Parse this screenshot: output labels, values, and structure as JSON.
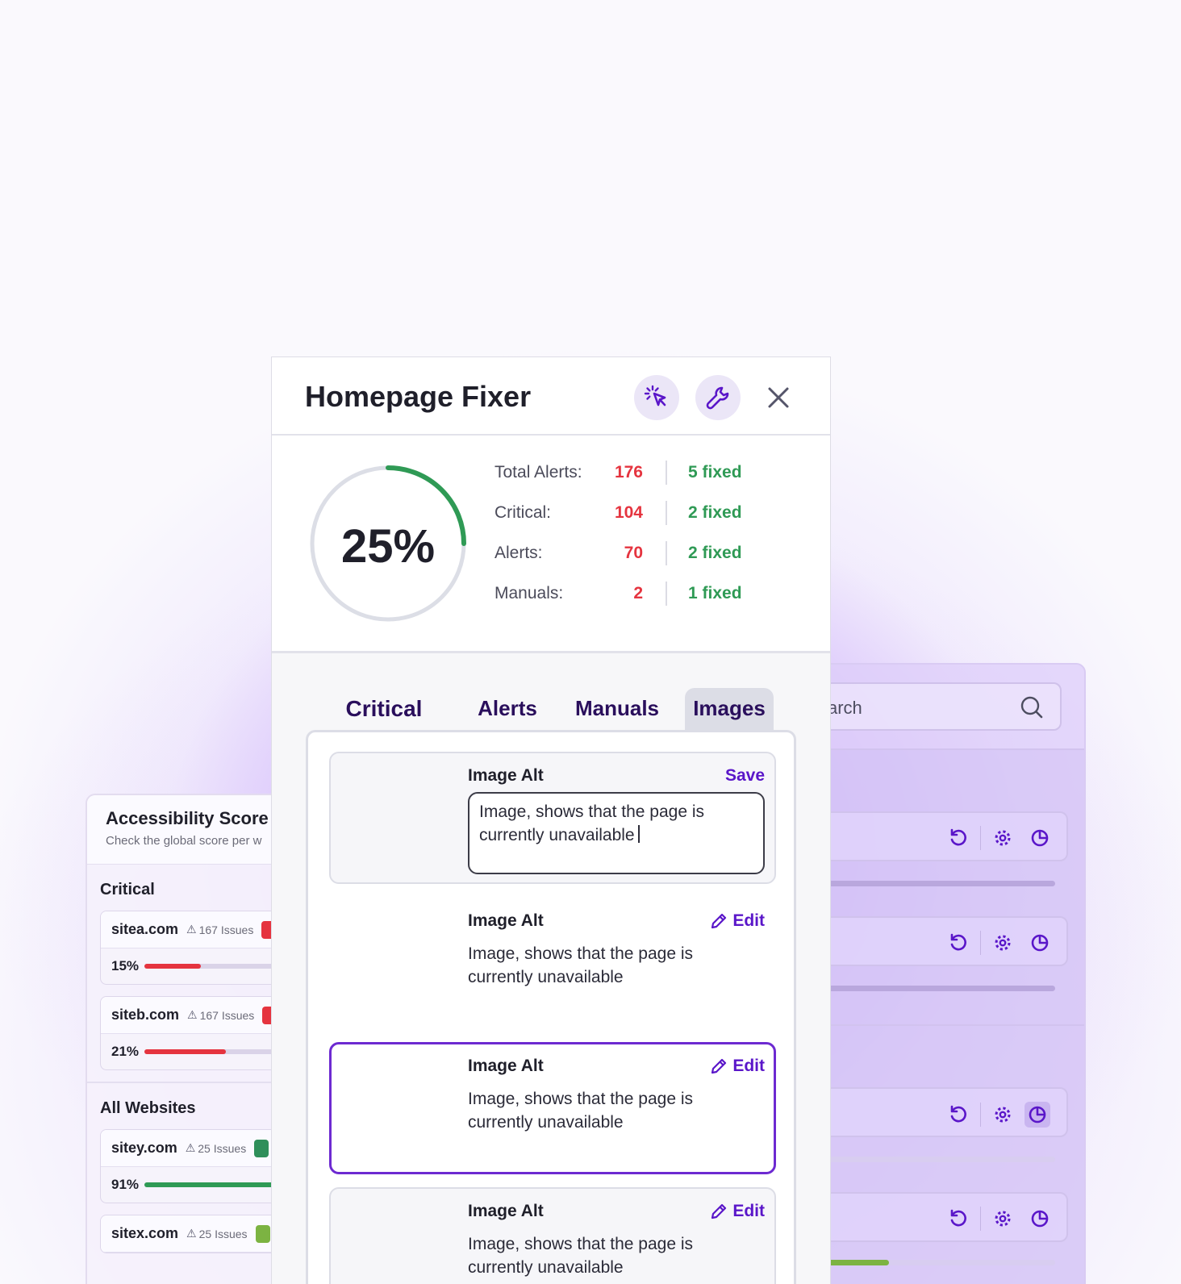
{
  "accessibility_card": {
    "title": "Accessibility Score",
    "subtitle": "Check the global score per w",
    "critical_heading": "Critical",
    "all_heading": "All Websites",
    "critical_sites": [
      {
        "name": "sitea.com",
        "issues": "167 Issues",
        "score": "15%",
        "progress": 0.38,
        "color": "#e5343f"
      },
      {
        "name": "siteb.com",
        "issues": "167 Issues",
        "score": "21%",
        "progress": 0.55,
        "color": "#e5343f"
      }
    ],
    "all_sites": [
      {
        "name": "sitey.com",
        "issues": "25 Issues",
        "score": "91%",
        "progress": 1.0,
        "color": "#2f9a55"
      },
      {
        "name": "sitex.com",
        "issues": "25 Issues",
        "score": "",
        "progress": 0,
        "color": "#7cb342"
      }
    ]
  },
  "search": {
    "placeholder": "arch"
  },
  "panel": {
    "title": "Homepage Fixer",
    "score": "25%",
    "score_progress": 0.25,
    "stats": [
      {
        "label": "Total Alerts:",
        "value": "176",
        "fixed": "5 fixed"
      },
      {
        "label": "Critical:",
        "value": "104",
        "fixed": "2 fixed"
      },
      {
        "label": "Alerts:",
        "value": "70",
        "fixed": "2 fixed"
      },
      {
        "label": "Manuals:",
        "value": "2",
        "fixed": "1 fixed"
      }
    ],
    "tabs": [
      "Critical",
      "Alerts",
      "Manuals",
      "Images"
    ],
    "active_tab": "Images",
    "items": [
      {
        "label": "Image Alt",
        "action": "Save",
        "text": "Image, shows that the page is currently unavailable"
      },
      {
        "label": "Image Alt",
        "action": "Edit",
        "text": "Image, shows that the page is currently unavailable"
      },
      {
        "label": "Image Alt",
        "action": "Edit",
        "text": "Image, shows that the page is currently unavailable"
      },
      {
        "label": "Image Alt",
        "action": "Edit",
        "text": "Image, shows that the page is currently unavailable"
      }
    ]
  },
  "colors": {
    "accent": "#5a16c9",
    "critical": "#e5343f",
    "fixed": "#2f9a55"
  },
  "icons": [
    "cursor-click-icon",
    "wrench-icon",
    "close-icon",
    "search-icon",
    "refresh-icon",
    "gear-icon",
    "pie-chart-icon",
    "pencil-icon",
    "warning-icon"
  ]
}
